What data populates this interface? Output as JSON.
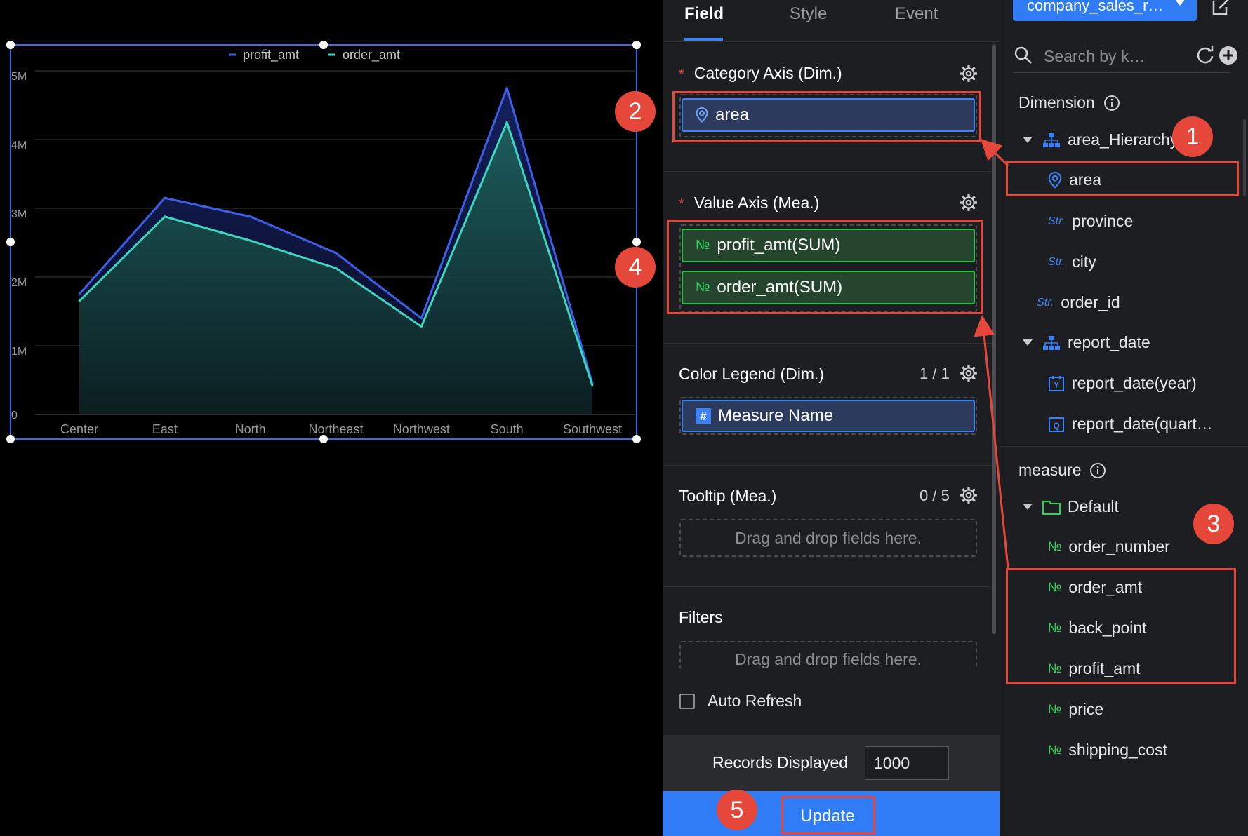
{
  "chart_data": {
    "type": "area",
    "categories": [
      "Center",
      "East",
      "North",
      "Northeast",
      "Northwest",
      "South",
      "Southwest"
    ],
    "series": [
      {
        "name": "profit_amt",
        "values": [
          1750000,
          3150000,
          2880000,
          2350000,
          1400000,
          4750000,
          450000
        ],
        "color": "#3b5fe6"
      },
      {
        "name": "order_amt",
        "values": [
          1650000,
          2880000,
          2530000,
          2130000,
          1280000,
          4250000,
          420000
        ],
        "color": "#3dd6c0"
      }
    ],
    "y_ticks": [
      "0",
      "1M",
      "2M",
      "3M",
      "4M",
      "5M"
    ],
    "ylim": [
      0,
      5000000
    ],
    "grid": true,
    "legend_position": "top-center"
  },
  "config_panel": {
    "tabs": [
      "Field",
      "Style",
      "Event"
    ],
    "active_tab": "Field",
    "category_axis": {
      "title": "Category Axis (Dim.)",
      "required_mark": "*",
      "field": "area"
    },
    "value_axis": {
      "title": "Value Axis (Mea.)",
      "required_mark": "*",
      "fields": [
        "profit_amt(SUM)",
        "order_amt(SUM)"
      ]
    },
    "color_legend": {
      "title": "Color Legend (Dim.)",
      "count": "1 / 1",
      "field": "Measure Name"
    },
    "tooltip": {
      "title": "Tooltip (Mea.)",
      "count": "0 / 5",
      "placeholder": "Drag and drop fields here."
    },
    "filters": {
      "title": "Filters",
      "placeholder": "Drag and drop fields here."
    },
    "auto_refresh_label": "Auto Refresh",
    "records_label": "Records Displayed",
    "records_value": "1000",
    "update_label": "Update"
  },
  "field_panel": {
    "dataset": "company_sales_r…",
    "search_placeholder": "Search by k…",
    "dimension_title": "Dimension",
    "dimensions": [
      {
        "label": "area_Hierarchy",
        "icon": "hierarchy-icon"
      },
      {
        "label": "area",
        "icon": "location-pin-icon"
      },
      {
        "label": "province",
        "icon": "Str."
      },
      {
        "label": "city",
        "icon": "Str."
      },
      {
        "label": "order_id",
        "icon": "Str."
      },
      {
        "label": "report_date",
        "icon": "hierarchy-icon"
      },
      {
        "label": "report_date(year)",
        "icon": "year-icon"
      },
      {
        "label": "report_date(quart…",
        "icon": "quarter-icon"
      }
    ],
    "measure_title": "measure",
    "measure_folder": "Default",
    "measures": [
      {
        "label": "order_number",
        "icon": "№"
      },
      {
        "label": "order_amt",
        "icon": "№"
      },
      {
        "label": "back_point",
        "icon": "№"
      },
      {
        "label": "profit_amt",
        "icon": "№"
      },
      {
        "label": "price",
        "icon": "№"
      },
      {
        "label": "shipping_cost",
        "icon": "№"
      }
    ]
  },
  "annotations": [
    "1",
    "2",
    "3",
    "4",
    "5"
  ]
}
